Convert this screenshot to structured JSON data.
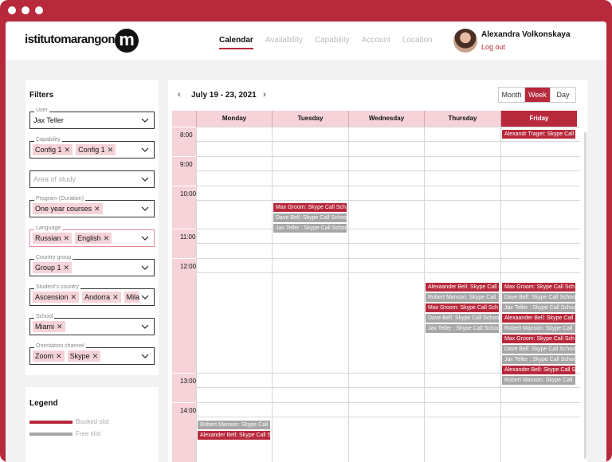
{
  "header": {
    "logo": "istitutomarangoni",
    "logo_mark": "m",
    "nav": [
      "Calendar",
      "Availability",
      "Capability",
      "Account",
      "Location"
    ],
    "user_name": "Alexandra Volkonskaya",
    "logout": "Log out"
  },
  "filters": {
    "title": "Filters",
    "user": {
      "label": "User",
      "value": "Jax Teller"
    },
    "capability": {
      "label": "Capability",
      "chips": [
        "Config 1",
        "Config 1"
      ]
    },
    "area": {
      "placeholder": "Area of study"
    },
    "program": {
      "label": "Program (Duration)",
      "chips": [
        "One year courses"
      ]
    },
    "language": {
      "label": "Language",
      "chips": [
        "Russian",
        "English"
      ]
    },
    "country_group": {
      "label": "Country group",
      "chips": [
        "Group 1"
      ]
    },
    "student_country": {
      "label": "Student's country",
      "chips": [
        "Ascension",
        "Andorra",
        "Mila"
      ]
    },
    "school": {
      "label": "School",
      "chips": [
        "Miami"
      ]
    },
    "orientation": {
      "label": "Orientation channel",
      "chips": [
        "Zoom",
        "Skype"
      ]
    }
  },
  "legend": {
    "title": "Legend",
    "booked": "Booked slot",
    "free": "Free slot",
    "booked_color": "#b8293c",
    "free_color": "#a7a7a7"
  },
  "calendar": {
    "range": "July 19 - 23, 2021",
    "views": [
      "Month",
      "Week",
      "Day"
    ],
    "active_view": "Week",
    "days": [
      "Monday",
      "Tuesday",
      "Wednesday",
      "Thursday",
      "Friday"
    ],
    "today": "Friday",
    "times": [
      "8:00",
      "9:00",
      "10:00",
      "11:00",
      "12:00",
      "13:00",
      "14:00"
    ],
    "events": {
      "mon_14": [
        {
          "text": "Robert Manson: Skype Call",
          "type": "free"
        },
        {
          "text": "Alexander Bell: Skype Call S",
          "type": "booked"
        }
      ],
      "tue_10": [
        {
          "text": "Max Groom: Skype Call Sch",
          "type": "booked"
        },
        {
          "text": "Dave Bell: Skype Call Schoo",
          "type": "free"
        },
        {
          "text": "Jax Teller : Skype Call Schoo",
          "type": "free"
        }
      ],
      "thu_12": [
        {
          "text": "Alexaander Bell: Skype Call",
          "type": "booked"
        },
        {
          "text": "Robert Manson: Skype Call",
          "type": "free"
        },
        {
          "text": "Max Groom: Skype Call Sch",
          "type": "booked"
        },
        {
          "text": "Dave Bell: Skype Call Schoo",
          "type": "free"
        },
        {
          "text": "Jax Teller : Skype Call Schoo",
          "type": "free"
        }
      ],
      "fri_8": [
        {
          "text": "Alexandr Trager: Skype Call",
          "type": "booked"
        }
      ],
      "fri_12": [
        {
          "text": "Max Groom: Skype Call Sch",
          "type": "booked"
        },
        {
          "text": "Dave Bell: Skype Call Schoo",
          "type": "free"
        },
        {
          "text": "Jax Teller : Skype Call Schoo",
          "type": "free"
        },
        {
          "text": "Alexaander Bell: Skype Call",
          "type": "booked"
        },
        {
          "text": "Robert Manson: Skype Call",
          "type": "free"
        },
        {
          "text": "Max Groom: Skype Call Sch",
          "type": "booked"
        },
        {
          "text": "Dave Bell: Skype Call Schoo",
          "type": "free"
        },
        {
          "text": "Jax Teller : Skype Call Schoo",
          "type": "free"
        },
        {
          "text": "Alexander Bell: Skype Call S",
          "type": "booked"
        },
        {
          "text": "Robert Manson: Skype Call",
          "type": "free"
        }
      ]
    }
  }
}
